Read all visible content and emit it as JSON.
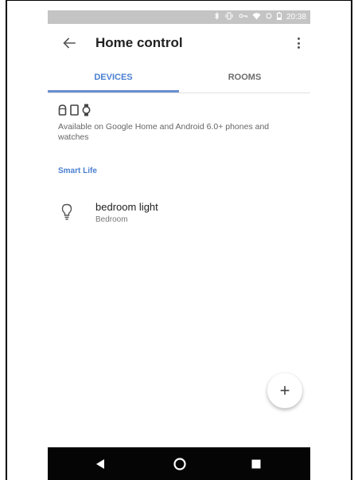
{
  "statusbar": {
    "icons": [
      "bluetooth-icon",
      "vibrate-icon",
      "vpn-key-icon",
      "wifi-icon",
      "data-icon",
      "battery-icon"
    ],
    "time": "20:38"
  },
  "appbar": {
    "title": "Home control",
    "back_icon": "arrow-back-icon",
    "menu_icon": "more-vert-icon"
  },
  "tabs": [
    {
      "label": "DEVICES",
      "active": true
    },
    {
      "label": "ROOMS",
      "active": false
    }
  ],
  "availability": {
    "icons": [
      "speaker-icon",
      "phone-icon",
      "watch-icon"
    ],
    "text": "Available on Google Home and Android 6.0+ phones and watches"
  },
  "section": {
    "label": "Smart Life"
  },
  "devices": [
    {
      "name": "bedroom light",
      "room": "Bedroom",
      "icon": "lightbulb-icon"
    }
  ],
  "fab": {
    "label": "+"
  },
  "navbar": {
    "icons": [
      "back-triangle-icon",
      "home-circle-icon",
      "recents-square-icon"
    ]
  },
  "colors": {
    "accent": "#4a7fcf",
    "statusbar": "#c4c4c4",
    "navbar": "#050505"
  }
}
